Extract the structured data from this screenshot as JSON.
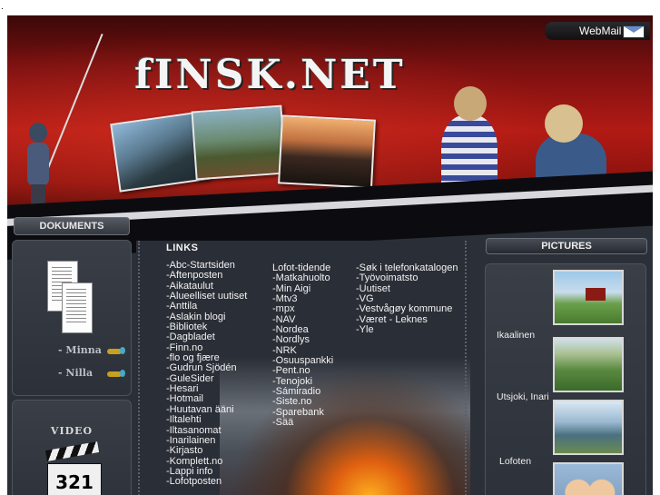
{
  "page": {
    "corner_mark": "."
  },
  "header": {
    "logo": "fINSK.NET",
    "webmail_label": "WebMail"
  },
  "left": {
    "documents_title": "DOKUMENTS",
    "doc_links": [
      "- Minna",
      "- Nilla"
    ],
    "video_title": "VIDEO",
    "video_icon_text": "321"
  },
  "links": {
    "title": "LINKS",
    "col1": [
      "-Abc-Startsiden",
      "-Aftenposten",
      "-Aikataulut",
      "-Alueelliset uutiset",
      "-Anttila",
      "-Aslakin blogi",
      "-Bibliotek",
      "-Dagbladet",
      "-Finn.no",
      "-flo og fjære",
      "-Gudrun Sjödén",
      "-GuleSider",
      "-Hesari",
      "-Hotmail",
      "-Huutavan ääni",
      "-Iltalehti",
      "-Iltasanomat",
      "-Inarilainen",
      "-Kirjasto",
      "-Komplett.no",
      "-Lappi info",
      "-Lofotposten"
    ],
    "col2": [
      "Lofot-tidende",
      "-Matkahuolto",
      "-Min Aigi",
      "-Mtv3",
      "-mpx",
      "-NAV",
      "-Nordea",
      "-Nordlys",
      "-NRK",
      "-Osuuspankki",
      "-Pent.no",
      "-Tenojoki",
      "-Sámiradio",
      "-Siste.no",
      "-Sparebank",
      "-Sää"
    ],
    "col3": [
      "-Søk i telefonkatalogen",
      "-Työvoimatsto",
      "-Uutiset",
      "-VG",
      "-Vestvågøy kommune",
      "-Været - Leknes",
      "-Yle"
    ]
  },
  "pictures": {
    "title": "PICTURES",
    "items": [
      {
        "label": "Ikaalinen"
      },
      {
        "label": "Utsjoki, Inari"
      },
      {
        "label": "Lofoten"
      },
      {
        "label": ""
      }
    ]
  },
  "colors": {
    "header_red": "#b21a14",
    "frame_bg": "#2b3038",
    "link_text": "#f2f2f2"
  }
}
